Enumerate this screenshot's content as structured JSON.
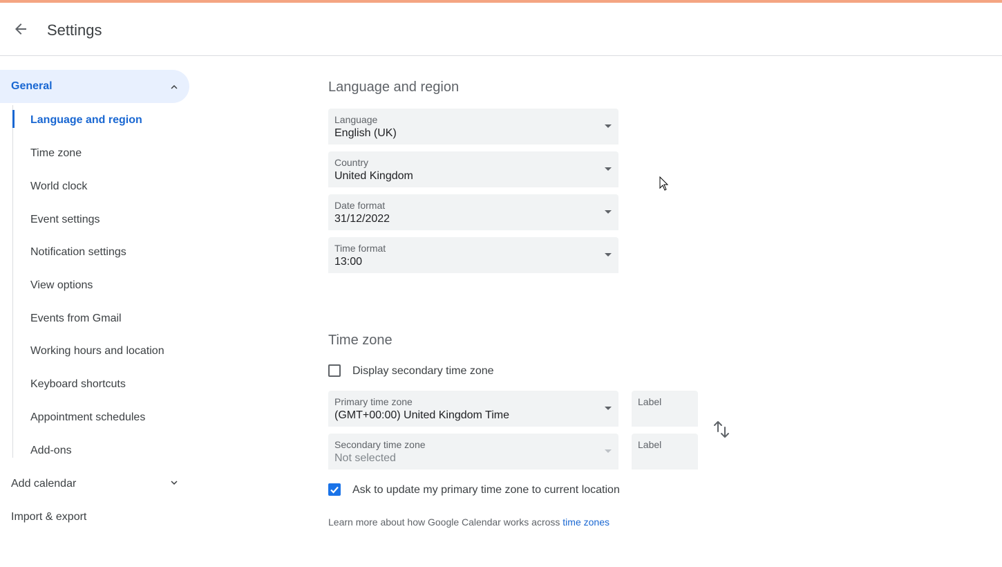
{
  "header": {
    "title": "Settings",
    "back_icon": "arrow-back-icon"
  },
  "sidebar": {
    "general": {
      "label": "General",
      "expanded": true
    },
    "sub_items": [
      {
        "label": "Language and region",
        "active": true
      },
      {
        "label": "Time zone"
      },
      {
        "label": "World clock"
      },
      {
        "label": "Event settings"
      },
      {
        "label": "Notification settings"
      },
      {
        "label": "View options"
      },
      {
        "label": "Events from Gmail"
      },
      {
        "label": "Working hours and location"
      },
      {
        "label": "Keyboard shortcuts"
      },
      {
        "label": "Appointment schedules"
      },
      {
        "label": "Add-ons"
      }
    ],
    "add_calendar": {
      "label": "Add calendar"
    },
    "import_export": {
      "label": "Import & export"
    }
  },
  "language_region": {
    "title": "Language and region",
    "language": {
      "label": "Language",
      "value": "English (UK)"
    },
    "country": {
      "label": "Country",
      "value": "United Kingdom"
    },
    "date_format": {
      "label": "Date format",
      "value": "31/12/2022"
    },
    "time_format": {
      "label": "Time format",
      "value": "13:00"
    }
  },
  "time_zone": {
    "title": "Time zone",
    "display_secondary": {
      "label": "Display secondary time zone",
      "checked": false
    },
    "primary": {
      "label": "Primary time zone",
      "value": "(GMT+00:00) United Kingdom Time",
      "label_placeholder": "Label"
    },
    "secondary": {
      "label": "Secondary time zone",
      "value": "Not selected",
      "label_placeholder": "Label"
    },
    "ask_update": {
      "label": "Ask to update my primary time zone to current location",
      "checked": true
    },
    "learn_more_text": "Learn more about how Google Calendar works across ",
    "learn_more_link": "time zones"
  },
  "colors": {
    "accent": "#1967d2",
    "active_bg": "#e8f0fe",
    "field_bg": "#f1f3f4",
    "checkbox_on": "#1a73e8"
  }
}
